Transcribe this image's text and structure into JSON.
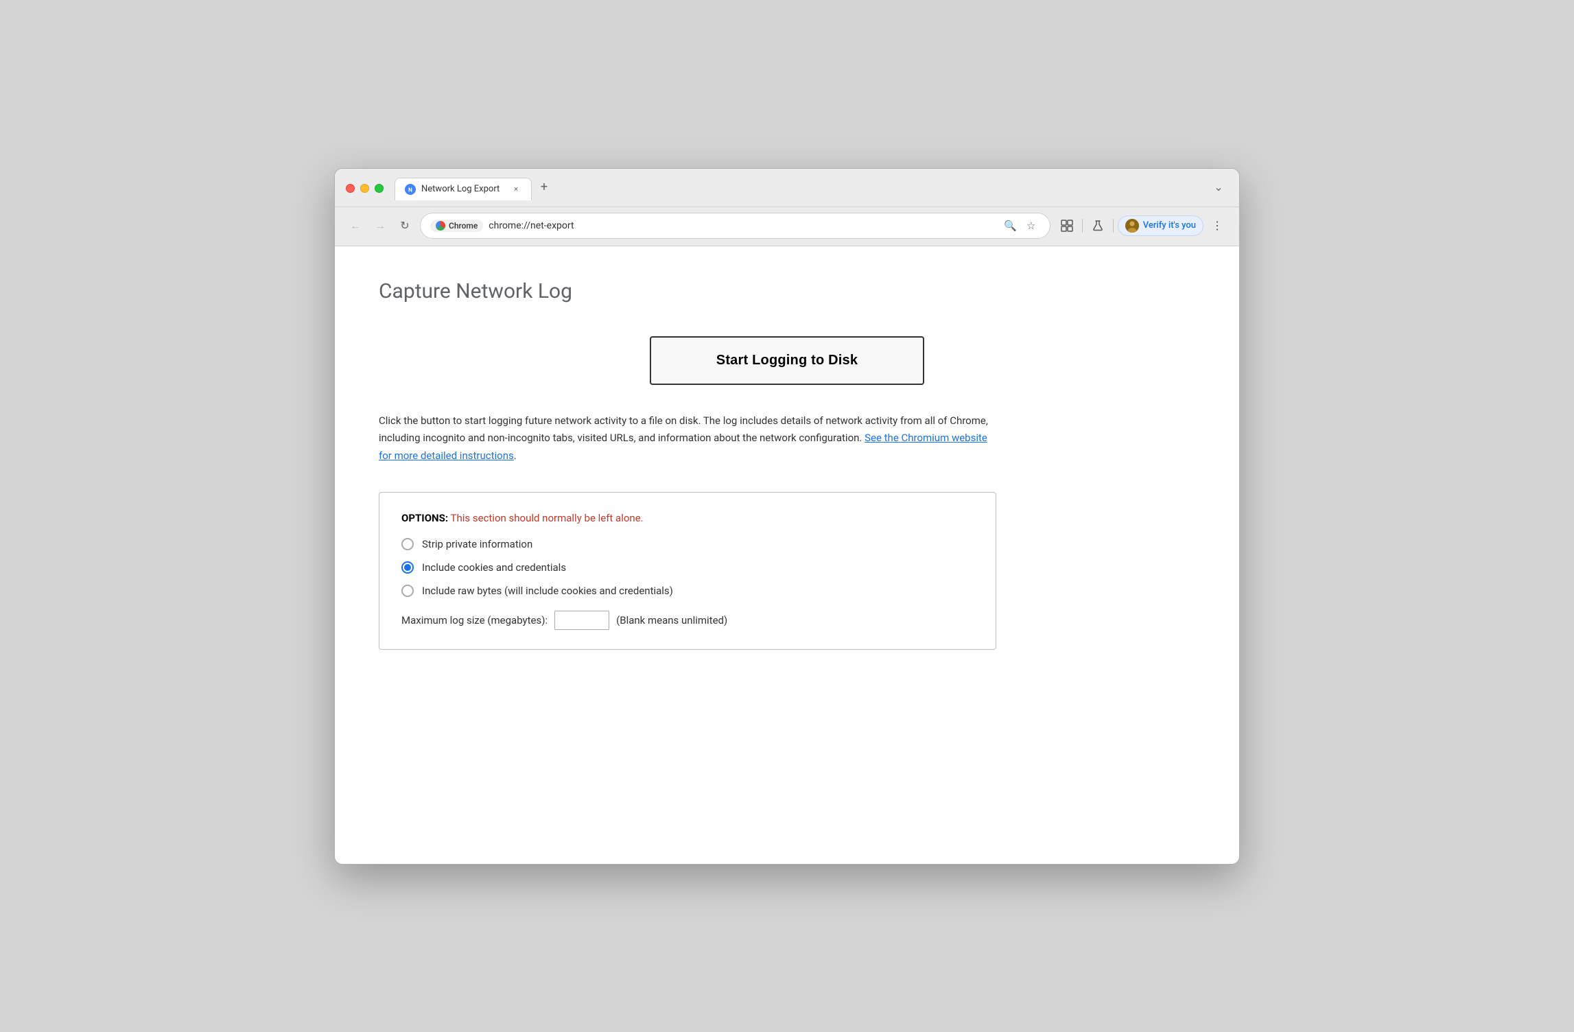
{
  "browser": {
    "tab": {
      "favicon_label": "N",
      "title": "Network Log Export",
      "close_label": "×",
      "new_tab_label": "+"
    },
    "chevron_label": "⌄",
    "nav": {
      "back_label": "←",
      "forward_label": "→",
      "reload_label": "↻"
    },
    "url_bar": {
      "chrome_badge": "Chrome",
      "url": "chrome://net-export"
    },
    "toolbar": {
      "search_icon": "🔍",
      "star_icon": "☆",
      "extension_icon": "⬜",
      "flask_icon": "⚗",
      "menu_icon": "⋮"
    },
    "profile": {
      "label": "Verify it's you"
    }
  },
  "page": {
    "title": "Capture Network Log",
    "start_button_label": "Start Logging to Disk",
    "description_text": "Click the button to start logging future network activity to a file on disk. The log includes details of network activity from all of Chrome, including incognito and non-incognito tabs, visited URLs, and information about the network configuration.",
    "description_link_text": "See the Chromium website for more detailed instructions",
    "options": {
      "header_label": "OPTIONS:",
      "header_warning": "This section should normally be left alone.",
      "radio_options": [
        {
          "label": "Strip private information",
          "selected": false
        },
        {
          "label": "Include cookies and credentials",
          "selected": true
        },
        {
          "label": "Include raw bytes (will include cookies and credentials)",
          "selected": false
        }
      ],
      "max_log_label": "Maximum log size (megabytes):",
      "max_log_placeholder": "",
      "max_log_suffix": "(Blank means unlimited)"
    }
  }
}
